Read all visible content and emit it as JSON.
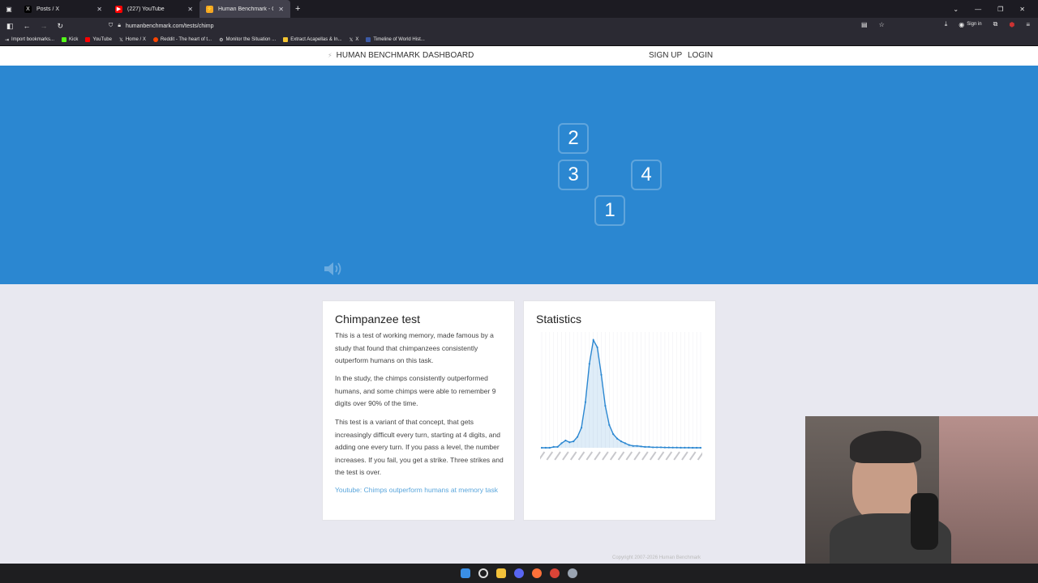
{
  "browser": {
    "tabs": [
      {
        "title": "Posts / X",
        "favicon": "X"
      },
      {
        "title": "(227) YouTube",
        "favicon": "youtube"
      },
      {
        "title": "Human Benchmark - Chimp Te",
        "favicon": "hb",
        "active": true
      }
    ],
    "url": "humanbenchmark.com/tests/chimp",
    "sign_in": "Sign in",
    "bookmarks": [
      "Import bookmarks...",
      "Kick",
      "YouTube",
      "Home / X",
      "Reddit - The heart of t...",
      "Monitor the Situation ...",
      "Extract Acapellas & In...",
      "X",
      "Timeline of World Hist..."
    ]
  },
  "header": {
    "brand": "HUMAN BENCHMARK",
    "dashboard": "DASHBOARD",
    "signup": "SIGN UP",
    "login": "LOGIN"
  },
  "test": {
    "cells": [
      {
        "label": "2"
      },
      {
        "label": "3"
      },
      {
        "label": "4"
      },
      {
        "label": "1"
      }
    ]
  },
  "about": {
    "title": "Chimpanzee test",
    "p1": "This is a test of working memory, made famous by a study that found that chimpanzees consistently outperform humans on this task.",
    "p2": "In the study, the chimps consistently outperformed humans, and some chimps were able to remember 9 digits over 90% of the time.",
    "p3": "This test is a variant of that concept, that gets increasingly difficult every turn, starting at 4 digits, and adding one every turn. If you pass a level, the number increases. If you fail, you get a strike. Three strikes and the test is over.",
    "link": "Youtube: Chimps outperform humans at memory task"
  },
  "stats": {
    "title": "Statistics"
  },
  "chart_data": {
    "type": "area",
    "x": [
      0,
      1,
      2,
      3,
      4,
      5,
      6,
      7,
      8,
      9,
      10,
      11,
      12,
      13,
      14,
      15,
      16,
      17,
      18,
      19,
      20,
      21,
      22,
      23,
      24,
      25,
      26,
      27,
      28,
      29,
      30,
      31,
      32,
      33,
      34,
      35,
      36,
      37,
      38,
      39,
      40
    ],
    "values": [
      0,
      0,
      0,
      1,
      1,
      5,
      8,
      6,
      7,
      12,
      22,
      50,
      92,
      118,
      110,
      80,
      46,
      25,
      15,
      10,
      7,
      5,
      3,
      2,
      2,
      1.5,
      1,
      1,
      0.5,
      0.5,
      0.5,
      0.3,
      0.3,
      0.2,
      0.2,
      0.1,
      0.1,
      0.1,
      0,
      0,
      0
    ]
  },
  "footer": {
    "copyright": "Copyright 2007-2026 Human Benchmark"
  },
  "colors": {
    "test_bg": "#2b87d1",
    "chart_line": "#2b87d1",
    "link": "#5aa6dc"
  }
}
